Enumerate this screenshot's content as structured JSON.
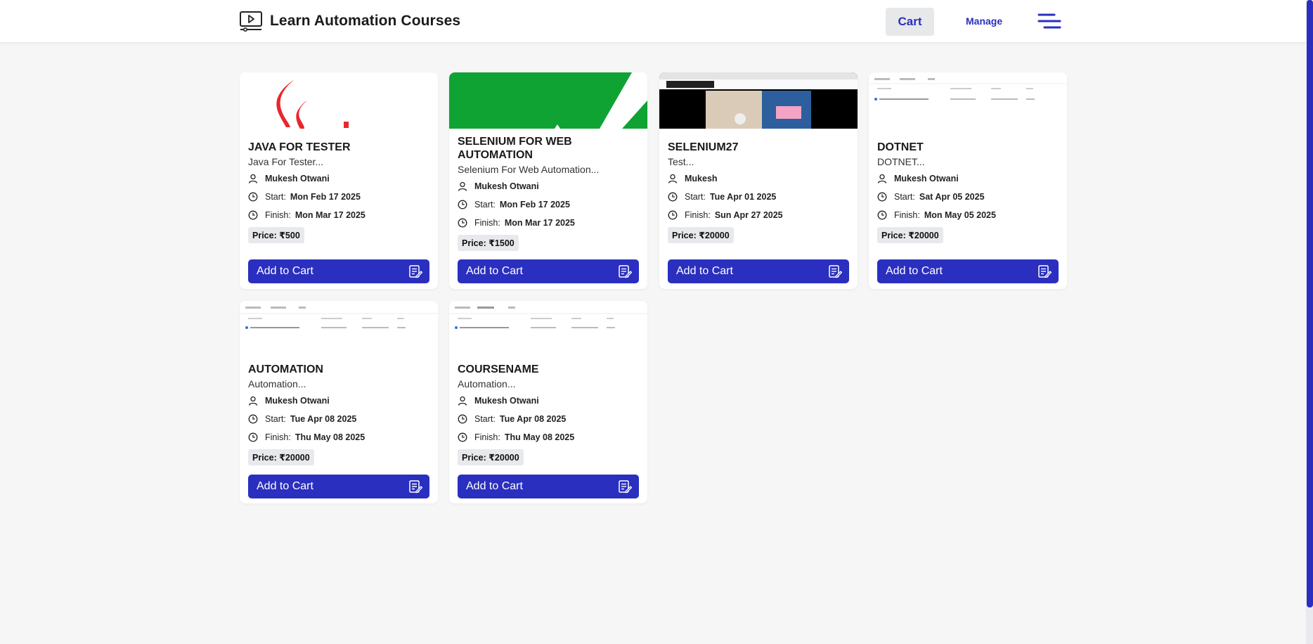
{
  "header": {
    "title": "Learn Automation Courses",
    "cart_label": "Cart",
    "manage_label": "Manage"
  },
  "colors": {
    "accent": "#2a2fbf",
    "background": "#f5f6f5"
  },
  "courses": [
    {
      "title": "JAVA FOR TESTER",
      "desc": "Java For Tester...",
      "author": "Mukesh Otwani",
      "start_label": "Start:",
      "start": "Mon Feb 17 2025",
      "finish_label": "Finish:",
      "finish": "Mon Mar 17 2025",
      "price": "Price: ₹500",
      "button": "Add to Cart"
    },
    {
      "title": "SELENIUM FOR WEB AUTOMATION",
      "desc": "Selenium For Web Automation...",
      "author": "Mukesh Otwani",
      "start_label": "Start:",
      "start": "Mon Feb 17 2025",
      "finish_label": "Finish:",
      "finish": "Mon Mar 17 2025",
      "price": "Price: ₹1500",
      "button": "Add to Cart"
    },
    {
      "title": "SELENIUM27",
      "desc": "Test...",
      "author": "Mukesh",
      "start_label": "Start:",
      "start": "Tue Apr 01 2025",
      "finish_label": "Finish:",
      "finish": "Sun Apr 27 2025",
      "price": "Price: ₹20000",
      "button": "Add to Cart"
    },
    {
      "title": "DOTNET",
      "desc": "DOTNET...",
      "author": "Mukesh Otwani",
      "start_label": "Start:",
      "start": "Sat Apr 05 2025",
      "finish_label": "Finish:",
      "finish": "Mon May 05 2025",
      "price": "Price: ₹20000",
      "button": "Add to Cart"
    },
    {
      "title": "AUTOMATION",
      "desc": "Automation...",
      "author": "Mukesh Otwani",
      "start_label": "Start:",
      "start": "Tue Apr 08 2025",
      "finish_label": "Finish:",
      "finish": "Thu May 08 2025",
      "price": "Price: ₹20000",
      "button": "Add to Cart"
    },
    {
      "title": "COURSENAME",
      "desc": "Automation...",
      "author": "Mukesh Otwani",
      "start_label": "Start:",
      "start": "Tue Apr 08 2025",
      "finish_label": "Finish:",
      "finish": "Thu May 08 2025",
      "price": "Price: ₹20000",
      "button": "Add to Cart"
    }
  ]
}
